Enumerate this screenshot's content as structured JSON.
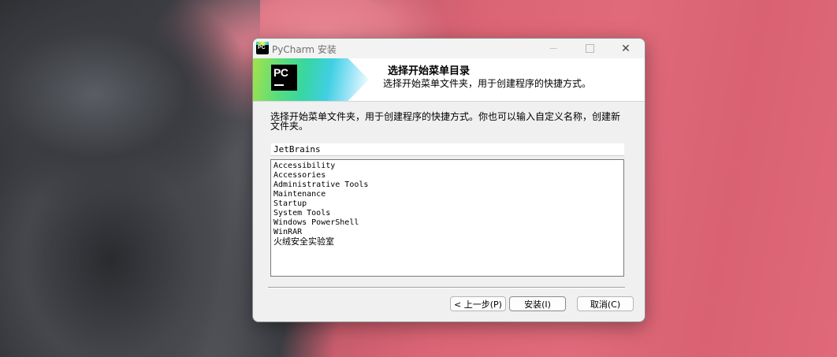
{
  "window": {
    "title": "PyCharm 安装",
    "icon_text": "PC",
    "minimize_glyph": "—",
    "close_glyph": "✕"
  },
  "header": {
    "logo_text": "PC",
    "title": "选择开始菜单目录",
    "subtitle": "选择开始菜单文件夹，用于创建程序的快捷方式。"
  },
  "description": "选择开始菜单文件夹，用于创建程序的快捷方式。你也可以输入自定义名称，创建新文件夹。",
  "folder_input": {
    "value": "JetBrains"
  },
  "folder_list": [
    "Accessibility",
    "Accessories",
    "Administrative Tools",
    "Maintenance",
    "Startup",
    "System Tools",
    "Windows PowerShell",
    "WinRAR",
    "火绒安全实验室"
  ],
  "buttons": {
    "back": "< 上一步(P)",
    "install": "安装(I)",
    "cancel": "取消(C)"
  },
  "colors": {
    "accent_green": "#21d789",
    "accent_cyan": "#07c3f2",
    "dialog_bg": "#f0f0f0"
  }
}
